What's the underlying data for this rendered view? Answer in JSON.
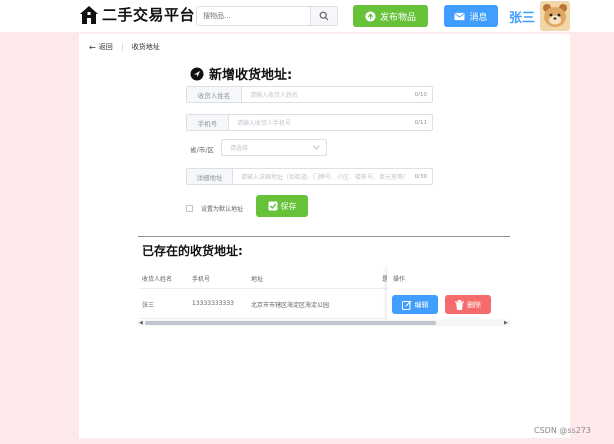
{
  "header": {
    "logo_text": "二手交易平台",
    "search_placeholder": "搜物品...",
    "publish_label": "发布物品",
    "message_label": "消息",
    "username": "张三"
  },
  "breadcrumb": {
    "back": "返回",
    "current": "收货地址"
  },
  "form": {
    "title": "新增收货地址:",
    "receiver_label": "收货人姓名",
    "receiver_placeholder": "请输入收货人姓名",
    "receiver_count": "0/10",
    "phone_label": "手机号",
    "phone_placeholder": "请输入收货人手机号",
    "phone_count": "0/11",
    "region_label": "省/市/区",
    "region_placeholder": "请选择",
    "detail_label": "详细地址",
    "detail_placeholder": "请输入详细地址（如街道、门牌号、小区、楼栋号、单元室等）",
    "detail_count": "0/30",
    "default_checkbox": "设置为默认地址",
    "save_label": "保存"
  },
  "saved": {
    "title": "已存在的收货地址:",
    "columns": [
      "收货人姓名",
      "手机号",
      "地址",
      "是",
      "操作"
    ],
    "rows": [
      {
        "name": "张三",
        "phone": "13333333333",
        "address": "北京市市辖区海淀区海淀公园"
      }
    ],
    "edit_label": "编辑",
    "delete_label": "删除"
  },
  "watermark": "CSDN @ss273",
  "colors": {
    "background": "#fde8ea",
    "success": "#67c23a",
    "primary": "#409eff",
    "danger": "#f56c6c"
  }
}
